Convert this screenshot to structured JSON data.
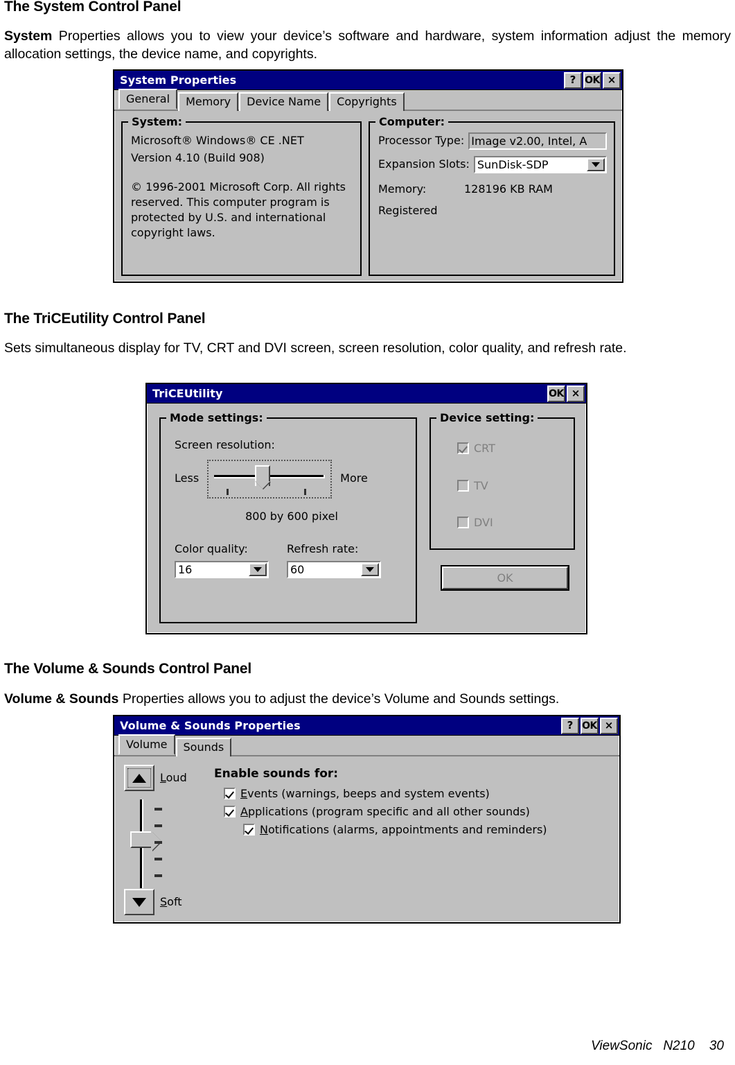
{
  "document": {
    "footer": {
      "brand": "ViewSonic",
      "model": "N210",
      "page_number": "30"
    }
  },
  "sections": [
    {
      "heading": "The System Control Panel",
      "lead": "System",
      "body": " Properties allows you to view your device’s software and hardware, system information adjust the memory allocation settings, the device name, and copyrights."
    },
    {
      "heading": "The TriCEutility Control Panel",
      "lead": "",
      "body": "Sets simultaneous display for TV, CRT and DVI screen, screen resolution, color quality, and refresh rate."
    },
    {
      "heading": "The Volume & Sounds Control Panel",
      "lead": "Volume & Sounds",
      "body": " Properties allows you to adjust the device’s Volume and Sounds settings."
    }
  ],
  "system_properties": {
    "title": "System Properties",
    "titlebar_buttons": {
      "help": "?",
      "ok": "OK",
      "close": "×"
    },
    "tabs": [
      {
        "label": "General",
        "active": true
      },
      {
        "label": "Memory",
        "active": false
      },
      {
        "label": "Device Name",
        "active": false
      },
      {
        "label": "Copyrights",
        "active": false
      }
    ],
    "system_group": {
      "label": "System:",
      "line1": "Microsoft® Windows® CE .NET",
      "line2": "Version 4.10 (Build 908)",
      "copyright": "© 1996-2001 Microsoft Corp. All rights reserved. This computer program is protected by U.S. and international copyright laws."
    },
    "computer_group": {
      "label": "Computer:",
      "processor_type_label": "Processor Type:",
      "processor_type_value": "Image v2.00, Intel, A",
      "expansion_slots_label": "Expansion Slots:",
      "expansion_slots_value": "SunDisk-SDP",
      "memory_label": "Memory:",
      "memory_value": "128196 KB  RAM",
      "registered_label": "Registered"
    }
  },
  "trice_utility": {
    "title": "TriCEUtility",
    "titlebar_buttons": {
      "ok": "OK",
      "close": "×"
    },
    "mode_settings": {
      "label": "Mode settings:",
      "screen_resolution_label": "Screen resolution:",
      "slider_min_label": "Less",
      "slider_max_label": "More",
      "resolution_value": "800 by 600 pixel",
      "color_quality_label": "Color quality:",
      "color_quality_value": "16",
      "refresh_rate_label": "Refresh rate:",
      "refresh_rate_value": "60"
    },
    "device_setting": {
      "label": "Device setting:",
      "options": [
        {
          "label": "CRT",
          "checked": true,
          "enabled": false
        },
        {
          "label": "TV",
          "checked": false,
          "enabled": false
        },
        {
          "label": "DVI",
          "checked": false,
          "enabled": false
        }
      ]
    },
    "ok_button": "OK"
  },
  "volume_sounds": {
    "title": "Volume & Sounds Properties",
    "titlebar_buttons": {
      "help": "?",
      "ok": "OK",
      "close": "×"
    },
    "tabs": [
      {
        "label": "Volume",
        "active": true
      },
      {
        "label": "Sounds",
        "active": false
      }
    ],
    "volume_slider": {
      "loud_label": "Loud",
      "loud_accel": "L",
      "soft_label": "Soft",
      "soft_accel": "S"
    },
    "enable_sounds": {
      "heading": "Enable sounds for:",
      "items": [
        {
          "accel": "E",
          "rest": "vents (warnings, beeps and system events)",
          "checked": true,
          "indent": 0
        },
        {
          "accel": "A",
          "rest": "pplications (program specific and all other sounds)",
          "checked": true,
          "indent": 0
        },
        {
          "accel": "N",
          "rest": "otifications (alarms, appointments and reminders)",
          "checked": true,
          "indent": 1
        }
      ]
    }
  },
  "colors": {
    "titlebar": "#000080",
    "dialog_face": "#c0c0c0",
    "disabled_text": "#808080"
  }
}
